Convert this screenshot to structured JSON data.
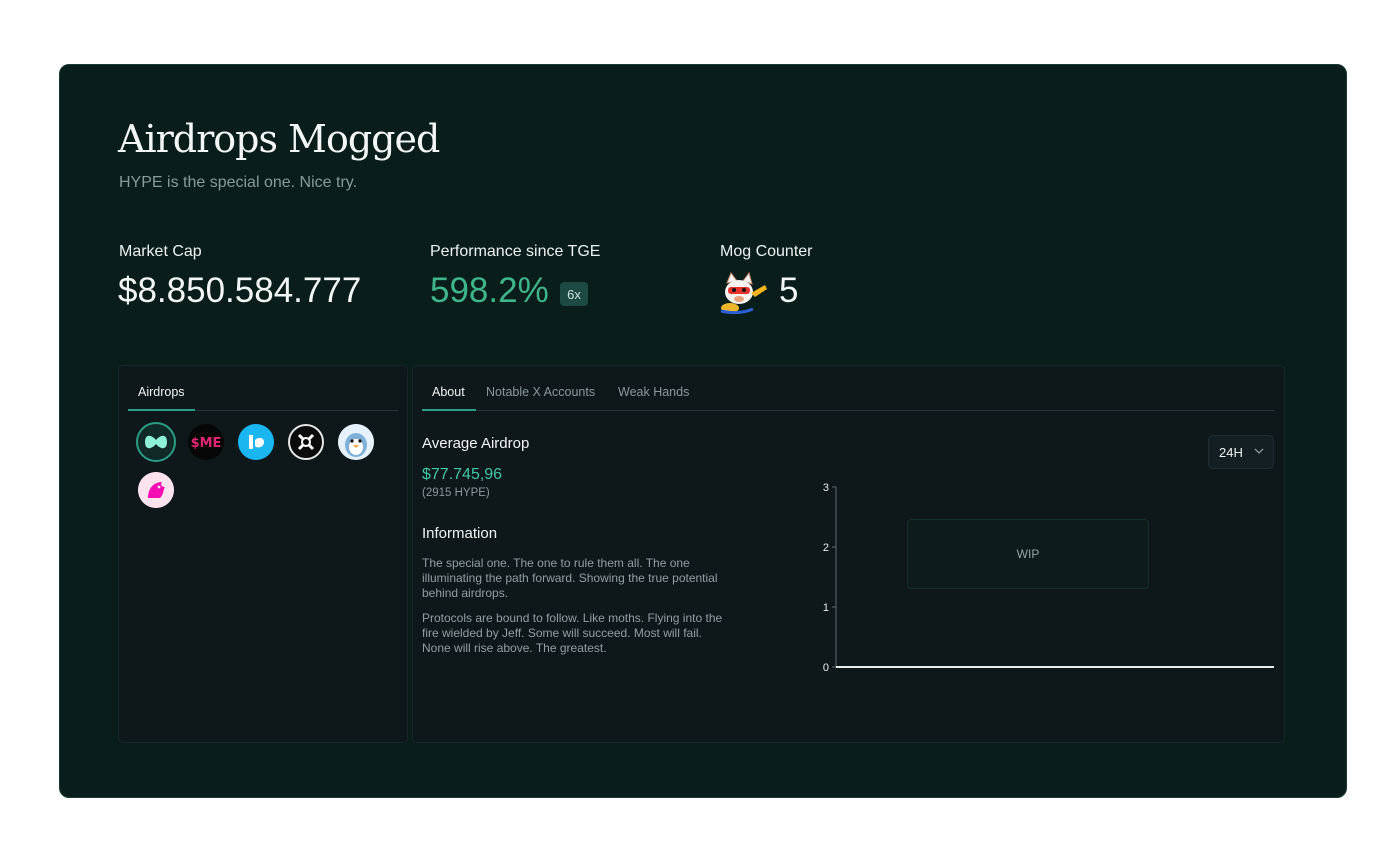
{
  "header": {
    "title": "Airdrops Mogged",
    "subtitle": "HYPE is the special one. Nice try."
  },
  "stats": {
    "market_cap": {
      "label": "Market Cap",
      "value": "$8.850.584.777"
    },
    "performance": {
      "label": "Performance since TGE",
      "value": "598.2%",
      "badge": "6x",
      "color": "#3fb58a"
    },
    "mog_counter": {
      "label": "Mog Counter",
      "value": "5",
      "icon": "mog-cat-icon"
    }
  },
  "airdrops_panel": {
    "tab_label": "Airdrops",
    "logos": [
      {
        "name": "hyperliquid-logo-icon",
        "selected": true
      },
      {
        "name": "magic-eden-logo-icon",
        "text": "$ME"
      },
      {
        "name": "wormhole-logo-icon"
      },
      {
        "name": "starknet-logo-icon"
      },
      {
        "name": "pudgy-penguins-logo-icon"
      },
      {
        "name": "uniswap-logo-icon"
      }
    ]
  },
  "detail_panel": {
    "tabs": [
      {
        "label": "About",
        "active": true
      },
      {
        "label": "Notable X Accounts",
        "active": false
      },
      {
        "label": "Weak Hands",
        "active": false
      }
    ],
    "average_airdrop": {
      "title": "Average Airdrop",
      "value": "$77.745,96",
      "sub": "(2915 HYPE)"
    },
    "information": {
      "title": "Information",
      "paragraphs": [
        "The special one. The one to rule them all. The one illuminating the path forward. Showing the true potential behind airdrops.",
        "Protocols are bound to follow. Like moths. Flying into the fire wielded by Jeff. Some will succeed. Most will fail. None will rise above. The greatest."
      ]
    },
    "timeframe": {
      "selected": "24H"
    },
    "chart_overlay": "WIP"
  },
  "chart_data": {
    "type": "line",
    "x": [],
    "series": [],
    "yticks": [
      "0",
      "1",
      "2",
      "3"
    ],
    "ylim": [
      0,
      3
    ],
    "grid": false,
    "legend": "none"
  },
  "colors": {
    "background": "#091e1b",
    "panel": "#0e181b",
    "accent": "#3fc9a7",
    "tab_underline": "#2e9f86"
  }
}
